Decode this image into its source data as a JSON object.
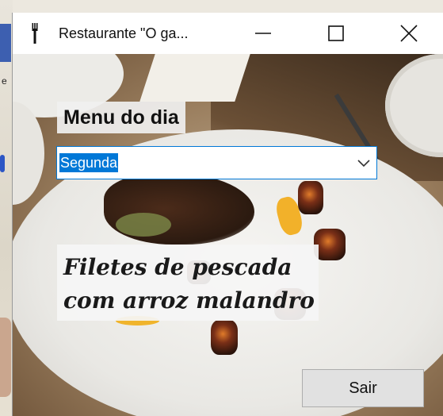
{
  "window": {
    "title": "Restaurante \"O ga...",
    "icon": "fork-icon",
    "controls": {
      "minimize_icon": "minimize-icon",
      "maximize_icon": "maximize-icon",
      "close_icon": "close-icon"
    }
  },
  "menu": {
    "label": "Menu do dia",
    "day_select": {
      "value": "Segunda",
      "icon": "chevron-down-icon"
    },
    "dish_line1": "Filetes de pescada",
    "dish_line2": "com arroz malandro"
  },
  "buttons": {
    "exit_label": "Sair"
  },
  "colors": {
    "accent": "#0078d7",
    "button_bg": "#e1e1e1"
  }
}
